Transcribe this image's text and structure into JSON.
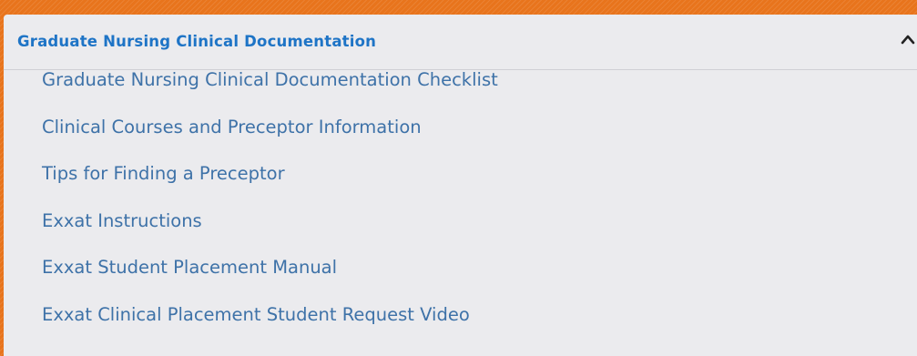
{
  "accordion": {
    "title": "Graduate Nursing Clinical Documentation",
    "expanded": true,
    "toggle_icon": "chevron-up-icon",
    "links": [
      {
        "label": "Graduate Nursing Clinical Documentation Checklist"
      },
      {
        "label": "Clinical Courses and Preceptor Information"
      },
      {
        "label": "Tips for Finding a Preceptor"
      },
      {
        "label": "Exxat Instructions"
      },
      {
        "label": "Exxat Student Placement Manual"
      },
      {
        "label": "Exxat Clinical Placement Student Request Video"
      }
    ]
  },
  "colors": {
    "background": "#e8741c",
    "panel": "#ebebee",
    "title": "#1e74c6",
    "link": "#3e72a8"
  }
}
